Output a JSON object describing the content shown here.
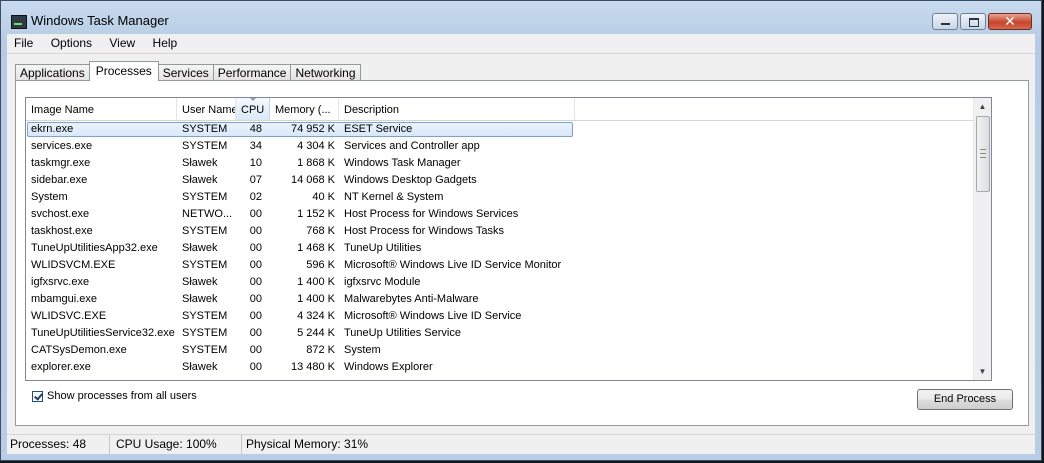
{
  "window": {
    "title": "Windows Task Manager"
  },
  "menu": [
    "File",
    "Options",
    "View",
    "Help"
  ],
  "tabs": [
    "Applications",
    "Processes",
    "Services",
    "Performance",
    "Networking"
  ],
  "active_tab": "Processes",
  "columns": [
    "Image Name",
    "User Name",
    "CPU",
    "Memory (...",
    "Description"
  ],
  "processes": [
    {
      "name": "ekrn.exe",
      "user": "SYSTEM",
      "cpu": "48",
      "memory": "74 952 K",
      "description": "ESET Service"
    },
    {
      "name": "services.exe",
      "user": "SYSTEM",
      "cpu": "34",
      "memory": "4 304 K",
      "description": "Services and Controller app"
    },
    {
      "name": "taskmgr.exe",
      "user": "Sławek",
      "cpu": "10",
      "memory": "1 868 K",
      "description": "Windows Task Manager"
    },
    {
      "name": "sidebar.exe",
      "user": "Sławek",
      "cpu": "07",
      "memory": "14 068 K",
      "description": "Windows Desktop Gadgets"
    },
    {
      "name": "System",
      "user": "SYSTEM",
      "cpu": "02",
      "memory": "40 K",
      "description": "NT Kernel & System"
    },
    {
      "name": "svchost.exe",
      "user": "NETWO...",
      "cpu": "00",
      "memory": "1 152 K",
      "description": "Host Process for Windows Services"
    },
    {
      "name": "taskhost.exe",
      "user": "SYSTEM",
      "cpu": "00",
      "memory": "768 K",
      "description": "Host Process for Windows Tasks"
    },
    {
      "name": "TuneUpUtilitiesApp32.exe",
      "user": "Sławek",
      "cpu": "00",
      "memory": "1 468 K",
      "description": "TuneUp Utilities"
    },
    {
      "name": "WLIDSVCM.EXE",
      "user": "SYSTEM",
      "cpu": "00",
      "memory": "596 K",
      "description": "Microsoft® Windows Live ID Service Monitor"
    },
    {
      "name": "igfxsrvc.exe",
      "user": "Sławek",
      "cpu": "00",
      "memory": "1 400 K",
      "description": "igfxsrvc Module"
    },
    {
      "name": "mbamgui.exe",
      "user": "Sławek",
      "cpu": "00",
      "memory": "1 400 K",
      "description": "Malwarebytes Anti-Malware"
    },
    {
      "name": "WLIDSVC.EXE",
      "user": "SYSTEM",
      "cpu": "00",
      "memory": "4 324 K",
      "description": "Microsoft® Windows Live ID Service"
    },
    {
      "name": "TuneUpUtilitiesService32.exe",
      "user": "SYSTEM",
      "cpu": "00",
      "memory": "5 244 K",
      "description": "TuneUp Utilities Service"
    },
    {
      "name": "CATSysDemon.exe",
      "user": "SYSTEM",
      "cpu": "00",
      "memory": "872 K",
      "description": "System"
    },
    {
      "name": "explorer.exe",
      "user": "Sławek",
      "cpu": "00",
      "memory": "13 480 K",
      "description": "Windows Explorer"
    }
  ],
  "selected_row": 0,
  "show_all_users": {
    "label": "Show processes from all users",
    "checked": true
  },
  "end_process_label": "End Process",
  "status": {
    "processes": "Processes: 48",
    "cpu": "CPU Usage: 100%",
    "memory": "Physical Memory: 31%"
  },
  "icons": {
    "app": "task-manager-icon",
    "minimize": "minimize-icon",
    "maximize": "maximize-icon",
    "close": "close-icon"
  }
}
